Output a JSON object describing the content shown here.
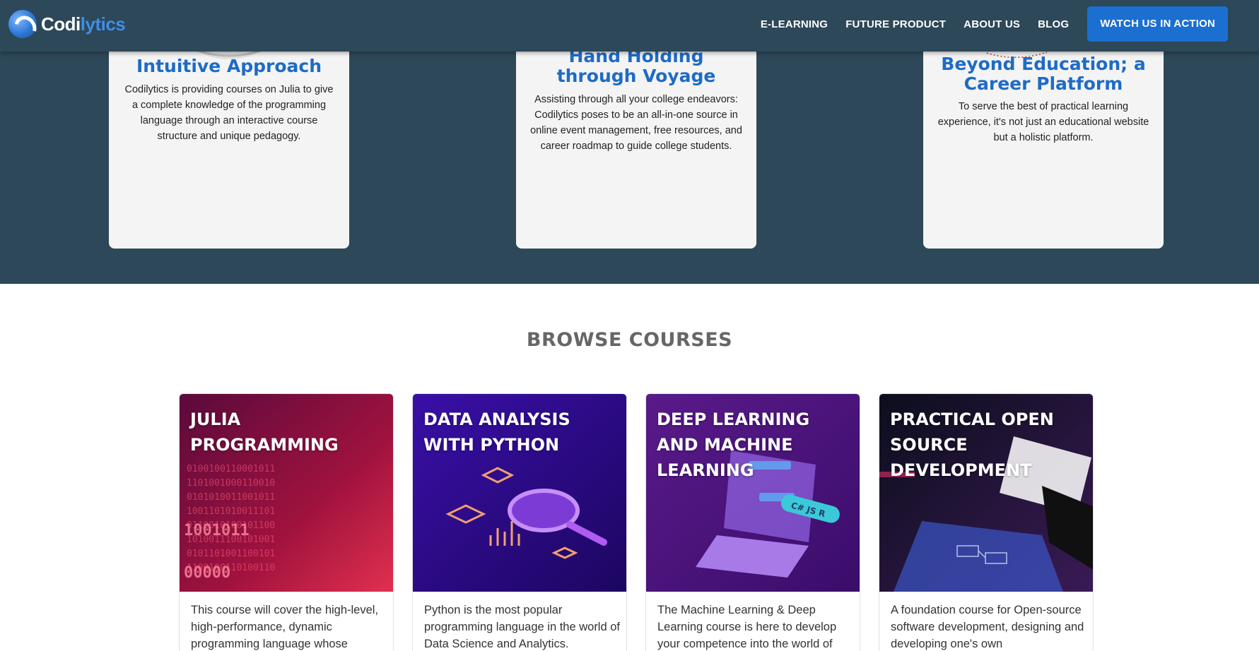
{
  "nav": {
    "logo_part1": "Codi",
    "logo_part2": "lytics",
    "links": [
      "E-LEARNING",
      "FUTURE PRODUCT",
      "ABOUT US",
      "BLOG"
    ],
    "cta": "WATCH US IN ACTION"
  },
  "features": [
    {
      "title": "Intuitive Approach",
      "description": "Codilytics is providing courses on Julia to give a complete knowledge of the programming language through an interactive course structure and unique pedagogy."
    },
    {
      "title": "Hand Holding through Voyage",
      "description": "Assisting through all your college endeavors: Codilytics poses to be an all-in-one source in online event management, free resources, and career roadmap to guide college students."
    },
    {
      "title": "Beyond Education; a Career Platform",
      "description": "To serve the best of practical learning experience, it's not just an educational website but a holistic platform."
    }
  ],
  "browse": {
    "title": "BROWSE COURSES",
    "courses": [
      {
        "title": "JULIA PROGRAMMING",
        "description": "This course will cover the high-level, high-performance, dynamic programming language whose"
      },
      {
        "title": "DATA ANALYSIS WITH PYTHON",
        "description": "Python is the most popular programming language in the world of Data Science and Analytics."
      },
      {
        "title": "DEEP LEARNING AND MACHINE LEARNING",
        "description": "The Machine Learning & Deep Learning course is here to develop your competence into the world of"
      },
      {
        "title": "PRACTICAL OPEN SOURCE DEVELOPMENT",
        "description": "A foundation course for Open-source software development, designing and developing one's own"
      }
    ]
  },
  "colors": {
    "navbar": "#2d4858",
    "accent": "#1a6fd1",
    "feature_title": "#1e6bc6"
  }
}
